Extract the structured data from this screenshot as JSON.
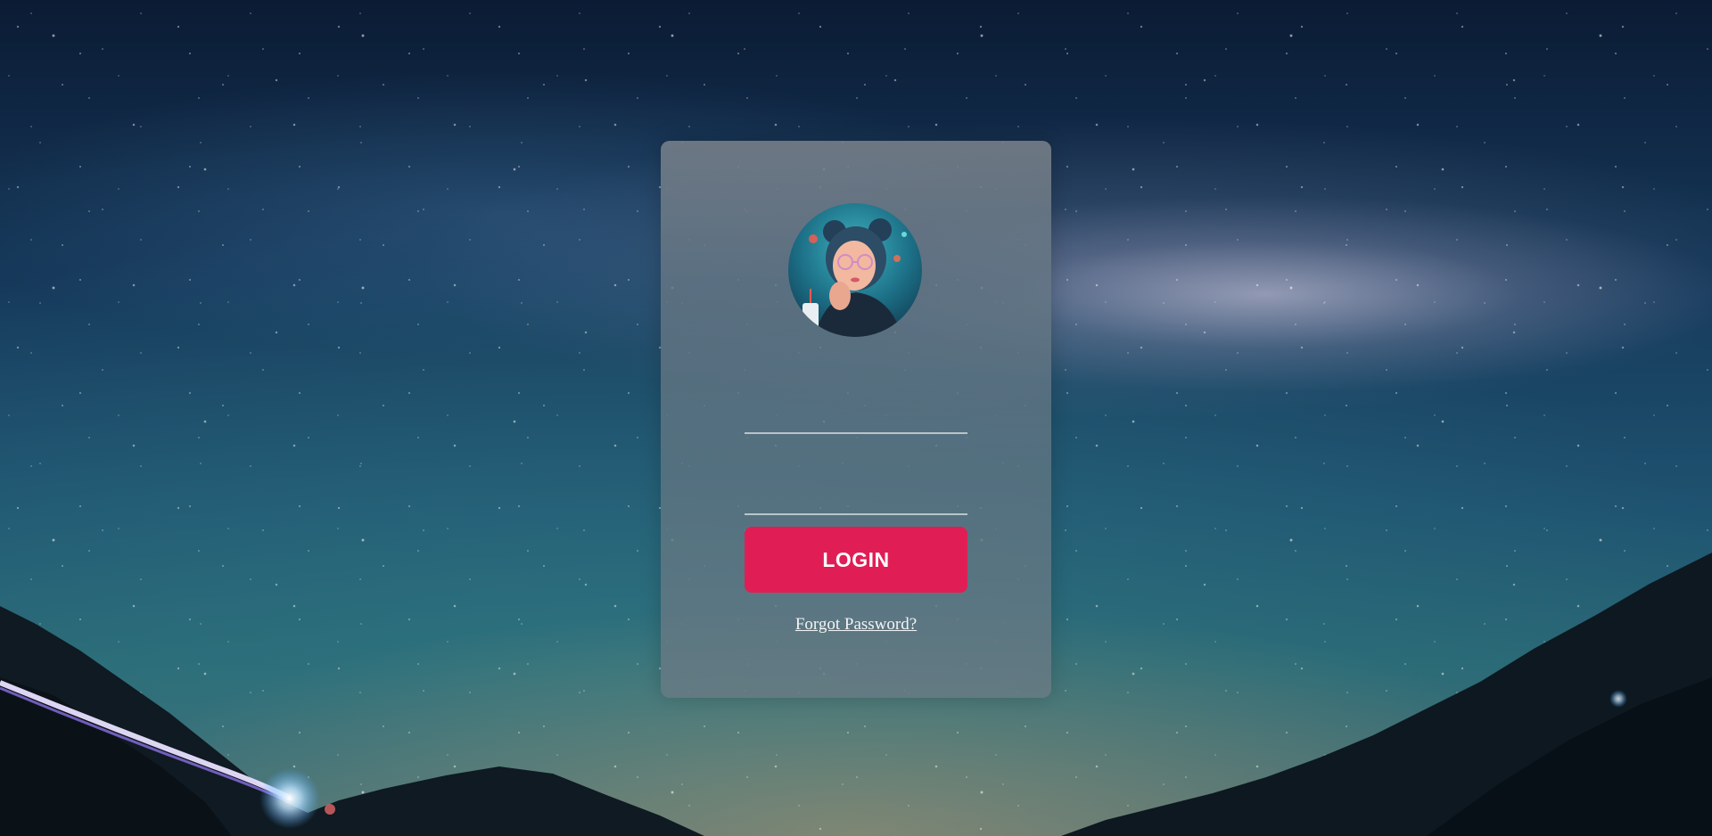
{
  "login_form": {
    "username_value": "",
    "password_value": "",
    "login_label": "LOGIN",
    "forgot_password_label": "Forgot Password?"
  },
  "colors": {
    "login_button": "#e01e55",
    "card_overlay": "#6b7d8a",
    "field_underline": "#cdd2d7"
  },
  "icons": {
    "avatar": "user-avatar-illustration"
  }
}
